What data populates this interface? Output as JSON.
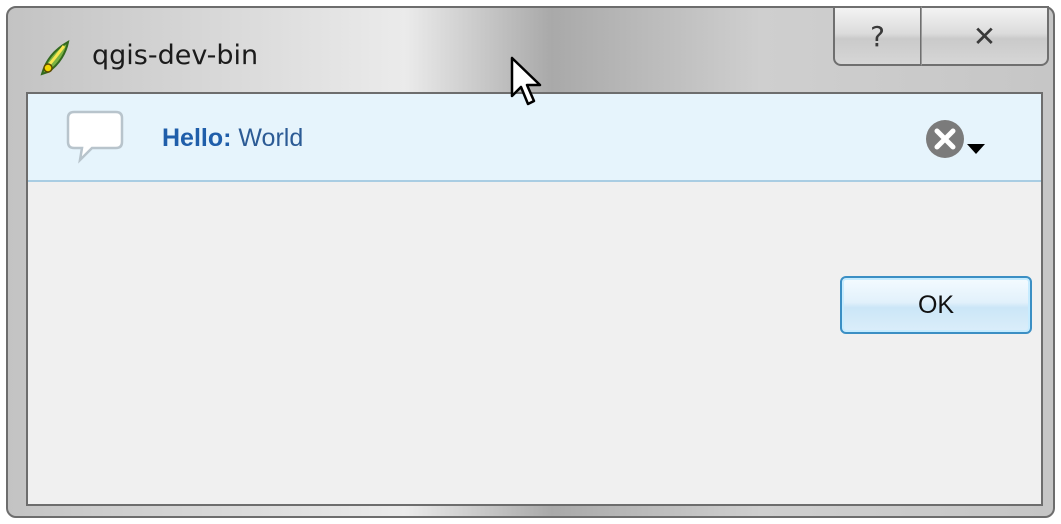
{
  "window": {
    "title": "qgis-dev-bin",
    "caption_buttons": [
      {
        "name": "help",
        "icon": "help-icon",
        "glyph": "?"
      },
      {
        "name": "close",
        "icon": "close-icon",
        "glyph": "✕"
      }
    ]
  },
  "message": {
    "title": "Hello:",
    "text": "World",
    "icon": "speech-bubble-icon",
    "dismiss_icon": "close-circle-icon"
  },
  "buttons": {
    "ok_label": "OK"
  },
  "colors": {
    "message_bar_bg": "#e6f4fc",
    "message_title": "#1f5eaa",
    "ok_border": "#3b8fc4"
  }
}
